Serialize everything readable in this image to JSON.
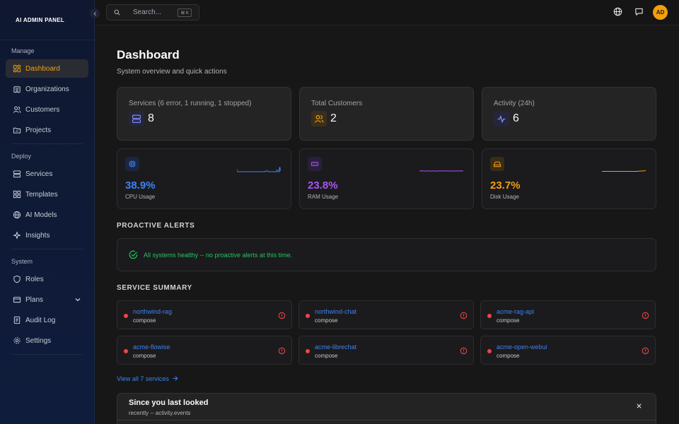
{
  "brand": "AI ADMIN PANEL",
  "sidebar": {
    "sections": [
      {
        "label": "Manage",
        "items": [
          {
            "label": "Dashboard",
            "icon": "dashboard-icon",
            "active": true
          },
          {
            "label": "Organizations",
            "icon": "building-icon"
          },
          {
            "label": "Customers",
            "icon": "users-icon"
          },
          {
            "label": "Projects",
            "icon": "folder-icon"
          }
        ]
      },
      {
        "label": "Deploy",
        "items": [
          {
            "label": "Services",
            "icon": "server-icon"
          },
          {
            "label": "Templates",
            "icon": "grid-icon"
          },
          {
            "label": "AI Models",
            "icon": "globe-icon"
          },
          {
            "label": "Insights",
            "icon": "sparkle-icon"
          }
        ]
      },
      {
        "label": "System",
        "items": [
          {
            "label": "Roles",
            "icon": "shield-icon"
          },
          {
            "label": "Plans",
            "icon": "card-icon"
          },
          {
            "label": "Audit Log",
            "icon": "log-icon"
          },
          {
            "label": "Settings",
            "icon": "gear-icon"
          }
        ]
      }
    ]
  },
  "topbar": {
    "search_placeholder": "Search...",
    "shortcut": "⌘ K",
    "avatar_initials": "AD"
  },
  "page": {
    "title": "Dashboard",
    "subtitle": "System overview and quick actions"
  },
  "stats": [
    {
      "label": "Services (6 error, 1 running, 1 stopped)",
      "value": "8",
      "icon": "server-icon",
      "color": "#818cf8",
      "bg": "#25263a"
    },
    {
      "label": "Total Customers",
      "value": "2",
      "icon": "users-icon",
      "color": "#f59e0b",
      "bg": "#3a2f1c"
    },
    {
      "label": "Activity (24h)",
      "value": "6",
      "icon": "activity-icon",
      "color": "#818cf8",
      "bg": "#25263a"
    }
  ],
  "resources": [
    {
      "label": "CPU Usage",
      "value": "38.9%",
      "percent": 38.9,
      "icon": "cpu-icon",
      "color": "#3b82f6",
      "bg": "#1c2640"
    },
    {
      "label": "RAM Usage",
      "value": "23.8%",
      "percent": 23.8,
      "icon": "memory-icon",
      "color": "#a855f7",
      "bg": "#2a1f3a"
    },
    {
      "label": "Disk Usage",
      "value": "23.7%",
      "percent": 23.7,
      "icon": "harddrive-icon",
      "color": "#f59e0b",
      "bg": "#3a2d18"
    }
  ],
  "alerts": {
    "title": "PROACTIVE ALERTS",
    "message": "All systems healthy -- no proactive alerts at this time."
  },
  "services": {
    "title": "SERVICE SUMMARY",
    "items": [
      {
        "name": "northwind-rag",
        "type": "compose"
      },
      {
        "name": "northwind-chat",
        "type": "compose"
      },
      {
        "name": "acme-rag-api",
        "type": "compose"
      },
      {
        "name": "acme-flowise",
        "type": "compose"
      },
      {
        "name": "acme-librechat",
        "type": "compose"
      },
      {
        "name": "acme-open-webui",
        "type": "compose"
      }
    ],
    "view_all": "View all 7 services"
  },
  "since": {
    "title": "Since you last looked",
    "subtitle": "recently -- activity.events"
  }
}
